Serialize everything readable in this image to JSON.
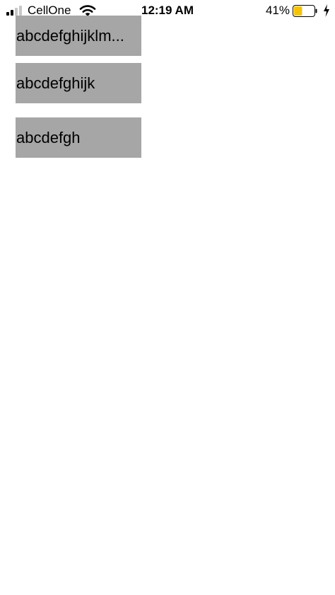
{
  "status_bar": {
    "carrier": "CellOne",
    "time": "12:19 AM",
    "battery_percent": "41%",
    "battery_level": 0.41,
    "signal_bars_filled": 2,
    "signal_bars_total": 4,
    "battery_color": "#f5c400",
    "icons": [
      "cellular-signal-icon",
      "wifi-icon",
      "battery-icon",
      "charging-bolt-icon"
    ]
  },
  "labels": [
    {
      "text": "abcdefghijklm..."
    },
    {
      "text": "abcdefghijk"
    },
    {
      "text": "abcdefgh"
    }
  ],
  "colors": {
    "label_background": "#a6a6a6",
    "page_background": "#ffffff"
  }
}
